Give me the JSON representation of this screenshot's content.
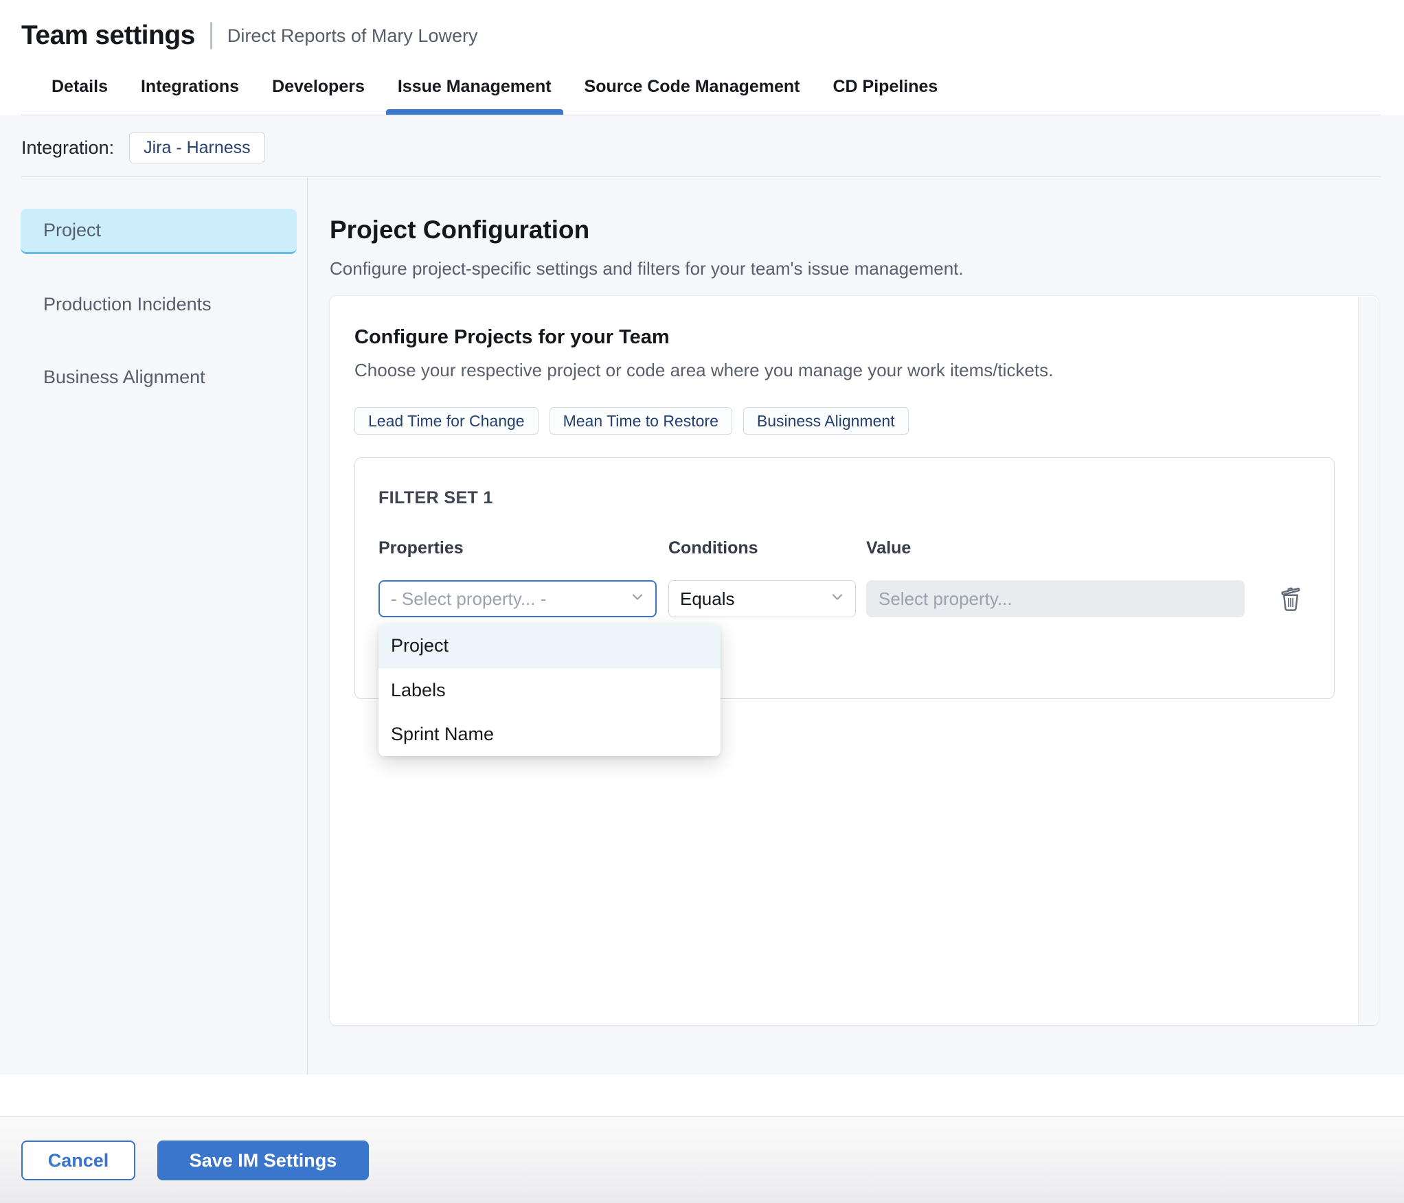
{
  "header": {
    "title": "Team settings",
    "subtitle": "Direct Reports of Mary Lowery",
    "tabs": [
      {
        "label": "Details",
        "active": false
      },
      {
        "label": "Integrations",
        "active": false
      },
      {
        "label": "Developers",
        "active": false
      },
      {
        "label": "Issue Management",
        "active": true
      },
      {
        "label": "Source Code Management",
        "active": false
      },
      {
        "label": "CD Pipelines",
        "active": false
      }
    ],
    "integration_label": "Integration:",
    "integration_value": "Jira - Harness"
  },
  "sidebar": {
    "items": [
      {
        "label": "Project",
        "selected": true
      },
      {
        "label": "Production Incidents",
        "selected": false
      },
      {
        "label": "Business Alignment",
        "selected": false
      }
    ]
  },
  "main": {
    "title": "Project Configuration",
    "description": "Configure project-specific settings and filters for your team's issue management.",
    "card": {
      "title": "Configure Projects for your Team",
      "description": "Choose your respective project or code area where you manage your work items/tickets.",
      "metric_chips": [
        {
          "label": "Lead Time for Change"
        },
        {
          "label": "Mean Time to Restore"
        },
        {
          "label": "Business Alignment"
        }
      ],
      "filter_set": {
        "title": "FILTER SET 1",
        "columns": {
          "properties": "Properties",
          "conditions": "Conditions",
          "value": "Value"
        },
        "property_placeholder": "- Select property... -",
        "condition_value": "Equals",
        "value_placeholder": "Select property...",
        "dropdown_options": [
          {
            "label": "Project",
            "highlighted": true
          },
          {
            "label": "Labels",
            "highlighted": false
          },
          {
            "label": "Sprint Name",
            "highlighted": false
          }
        ]
      }
    }
  },
  "footer": {
    "cancel_label": "Cancel",
    "save_label": "Save IM Settings"
  },
  "icons": {
    "chevron": "chevron-down-icon",
    "trash": "trash-icon"
  },
  "colors": {
    "accent_blue": "#3b76cd",
    "active_tab_underline": "#3b76cd",
    "selected_sidebar_bg": "#cbeefa",
    "selected_sidebar_border": "#64bce2",
    "dropdown_highlight_bg": "#ecf6fa",
    "chip_text": "#24406e",
    "page_background": "#f5f7fa",
    "disabled_field_bg": "#e8ecee"
  }
}
